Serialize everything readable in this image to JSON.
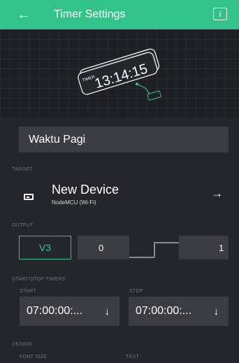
{
  "header": {
    "title": "Timer Settings",
    "back_icon": "arrow-left-icon",
    "info_icon": "info-icon",
    "info_glyph": "i",
    "color": "#34c28b"
  },
  "hero": {
    "widget_label": "TIMER",
    "widget_time": "13:14:15"
  },
  "name_field": {
    "value": "Waktu Pagi"
  },
  "target": {
    "label": "TARGET",
    "device_name": "New Device",
    "device_model": "NodeMCU (Wi-Fi)",
    "device_icon": "device-icon",
    "arrow_icon": "arrow-right-icon"
  },
  "output": {
    "label": "OUTPUT",
    "pin": "V3",
    "min": "0",
    "max": "1"
  },
  "timers": {
    "label": "START/STOP TIMERS",
    "start_label": "START",
    "start_value": "07:00:00:...",
    "stop_label": "STOP",
    "stop_value": "07:00:00:...",
    "dropdown_icon": "arrow-down-icon"
  },
  "design": {
    "label": "DESIGN",
    "font_size_label": "FONT SIZE",
    "text_label": "TEXT"
  }
}
